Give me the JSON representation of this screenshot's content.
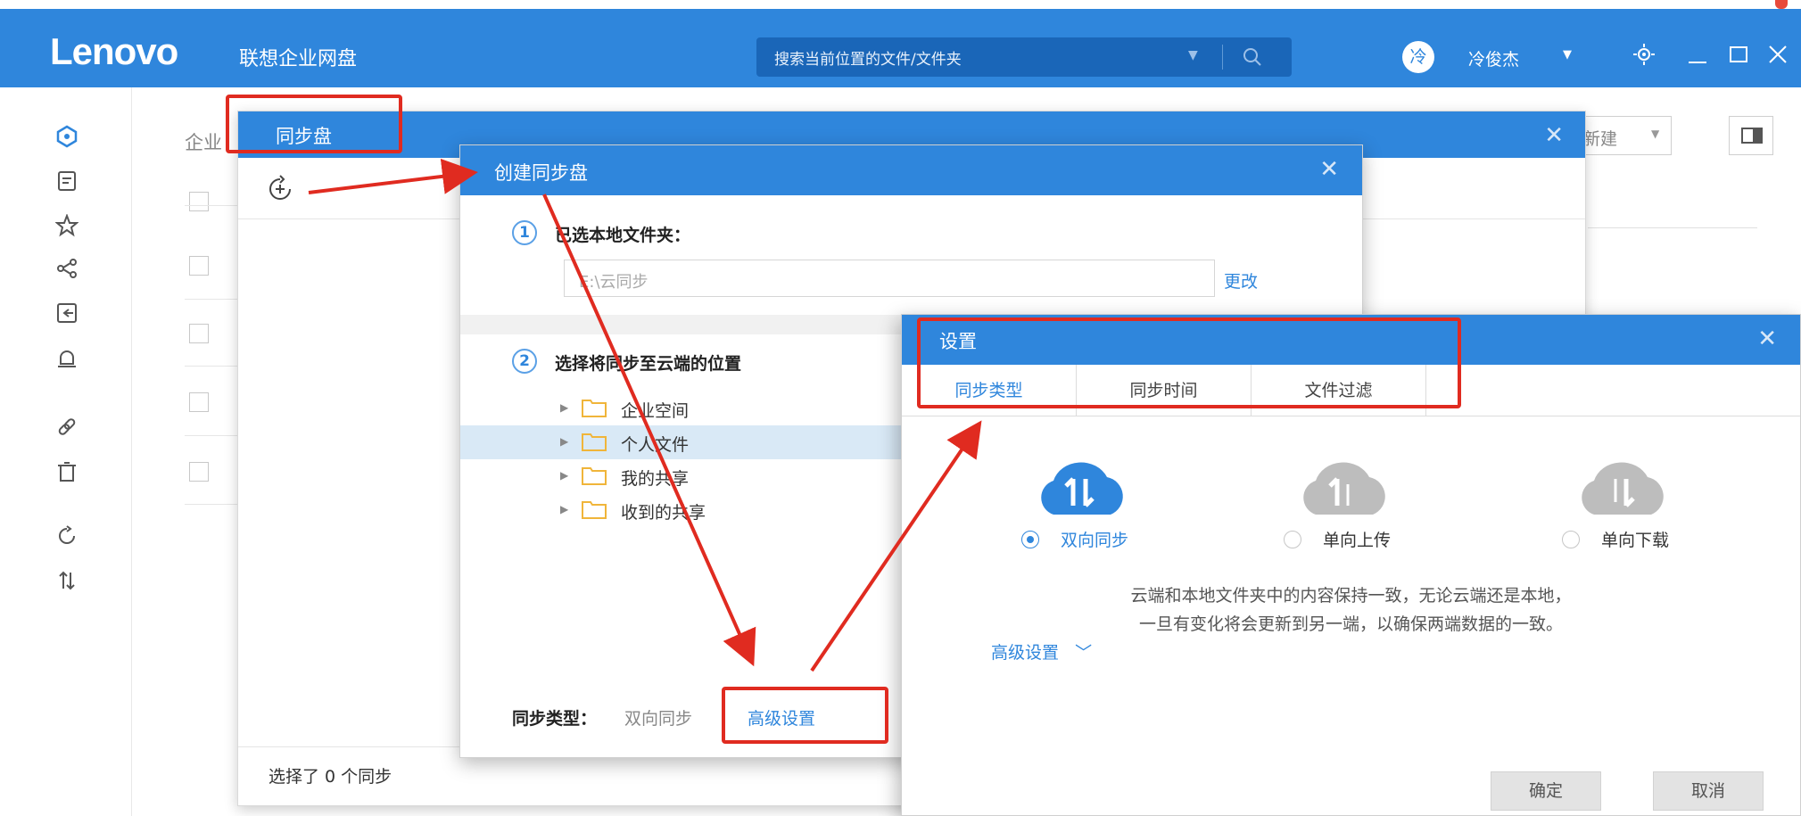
{
  "app": {
    "logo": "Lenovo",
    "name": "联想企业网盘"
  },
  "search": {
    "placeholder": "搜索当前位置的文件/文件夹"
  },
  "user": {
    "avatar": "冷",
    "name": "冷俊杰"
  },
  "background": {
    "breadcrumb": "企业",
    "new_button": "新建"
  },
  "sync_panel": {
    "title": "同步盘",
    "status": "选择了 0 个同步"
  },
  "create_dialog": {
    "title": "创建同步盘",
    "step1": {
      "num": "1",
      "label": "已选本地文件夹：",
      "path": "E:\\云同步",
      "change": "更改"
    },
    "step2": {
      "num": "2",
      "label": "选择将同步至云端的位置"
    },
    "tree": [
      {
        "label": "企业空间"
      },
      {
        "label": "个人文件"
      },
      {
        "label": "我的共享"
      },
      {
        "label": "收到的共享"
      }
    ],
    "footer": {
      "label": "同步类型：",
      "value": "双向同步",
      "advanced": "高级设置"
    }
  },
  "settings_dialog": {
    "title": "设置",
    "tabs": [
      {
        "label": "同步类型"
      },
      {
        "label": "同步时间"
      },
      {
        "label": "文件过滤"
      }
    ],
    "options": [
      {
        "label": "双向同步",
        "selected": true,
        "icon": "two-way-sync-cloud"
      },
      {
        "label": "单向上传",
        "selected": false,
        "icon": "upload-cloud"
      },
      {
        "label": "单向下载",
        "selected": false,
        "icon": "download-cloud"
      }
    ],
    "description_line1": "云端和本地文件夹中的内容保持一致，无论云端还是本地，",
    "description_line2": "一旦有变化将会更新到另一端，以确保两端数据的一致。",
    "advanced": "高级设置",
    "ok": "确定",
    "cancel": "取消"
  },
  "colors": {
    "primary": "#2f86dc",
    "annotation": "#e02b20",
    "selected_row": "#d9e9f6"
  }
}
